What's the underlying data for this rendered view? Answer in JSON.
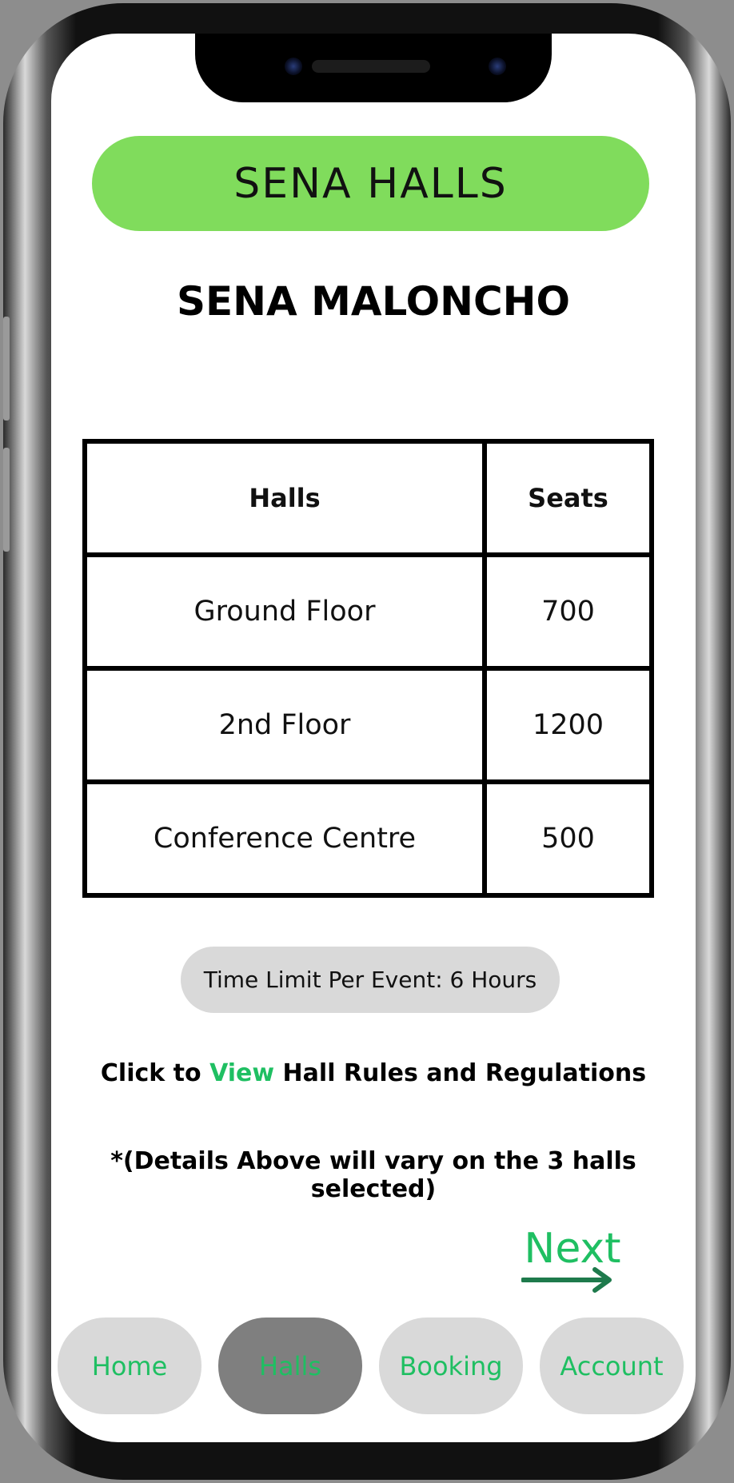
{
  "app": {
    "title": "SENA HALLS"
  },
  "venue": {
    "name": "SENA MALONCHO"
  },
  "table": {
    "headers": [
      "Halls",
      "Seats"
    ],
    "rows": [
      {
        "hall": "Ground Floor",
        "seats": "700"
      },
      {
        "hall": "2nd Floor",
        "seats": "1200"
      },
      {
        "hall": "Conference Centre",
        "seats": "500"
      }
    ]
  },
  "time_limit": "Time Limit Per Event: 6 Hours",
  "rules": {
    "prefix": "Click to ",
    "link": "View",
    "suffix": " Hall Rules and Regulations"
  },
  "disclaimer": "*(Details Above will vary on the 3 halls selected)",
  "next": {
    "label": "Next"
  },
  "nav": {
    "items": [
      {
        "label": "Home",
        "active": false
      },
      {
        "label": "Halls",
        "active": true
      },
      {
        "label": "Booking",
        "active": false
      },
      {
        "label": "Account",
        "active": false
      }
    ]
  },
  "colors": {
    "accent_green": "#80dc5c",
    "link_green": "#1fbf62",
    "arrow_green": "#1e7a4c",
    "pill_gray": "#d9d9d9",
    "active_gray": "#7f7f7f"
  }
}
